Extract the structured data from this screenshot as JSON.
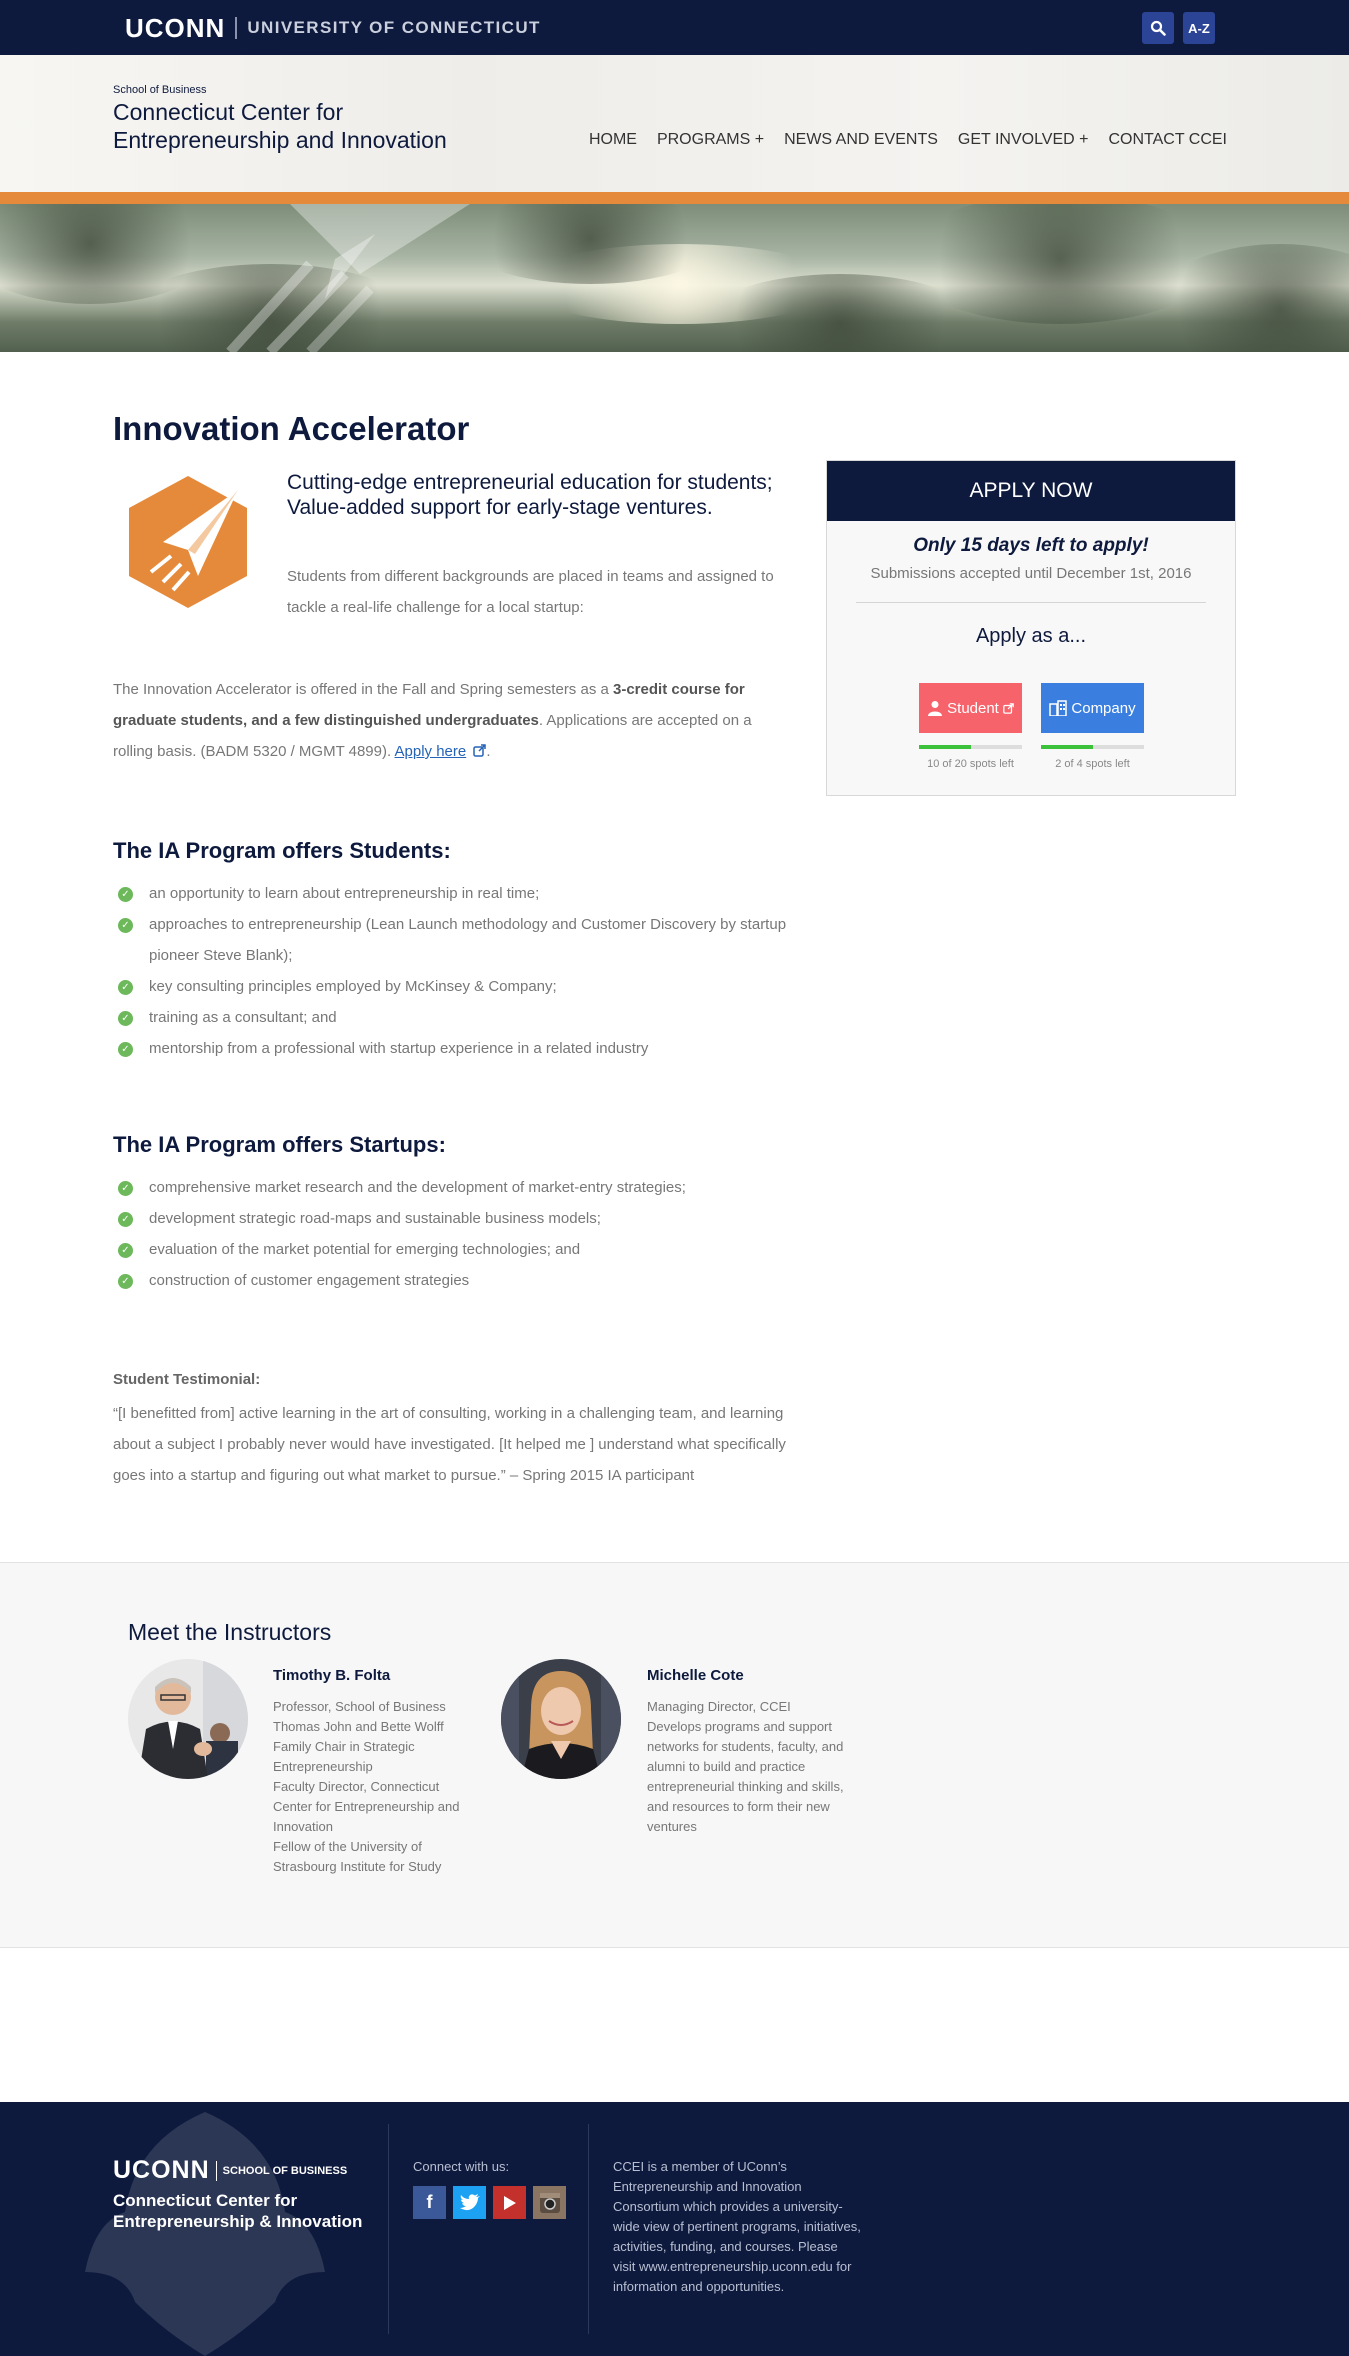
{
  "topbar": {
    "brand": "UCONN",
    "university": "UNIVERSITY OF CONNECTICUT",
    "search_icon": "search-icon",
    "az_label": "A-Z"
  },
  "header": {
    "school": "School of Business",
    "center_name": "Connecticut Center for Entrepreneurship and Innovation",
    "nav": [
      "HOME",
      "PROGRAMS +",
      "NEWS AND EVENTS",
      "GET INVOLVED +",
      "CONTACT CCEI"
    ]
  },
  "main": {
    "title": "Innovation Accelerator",
    "lead": "Cutting-edge entrepreneurial education for students; Value-added support for early-stage ventures.",
    "lead_text": "Students from different backgrounds are placed in teams and assigned to tackle a real-life challenge for a local startup:",
    "body_pre": "The Innovation Accelerator is offered in the Fall and Spring semesters as a ",
    "body_bold": "3-credit course for graduate students, and a few distinguished undergraduates",
    "body_post": ". Applications are accepted on a rolling basis. (BADM 5320 / MGMT 4899).  ",
    "apply_link": "Apply here",
    "students_heading": "The IA Program offers Students:",
    "students": [
      "an opportunity to learn about entrepreneurship in real time;",
      "approaches to entrepreneurship (Lean Launch methodology and Customer Discovery by startup pioneer Steve Blank);",
      "key consulting principles employed by McKinsey & Company;",
      "training as a consultant; and",
      "mentorship from a professional with startup experience in a related industry"
    ],
    "startups_heading": "The IA Program offers Startups:",
    "startups": [
      "comprehensive market research and the development of market-entry strategies;",
      "development strategic road-maps and sustainable business models;",
      "evaluation of the market potential for emerging technologies; and",
      "construction of customer engagement strategies"
    ],
    "testimonial_label": "Student Testimonial:",
    "testimonial": "“[I benefitted from] active learning in the art of consulting, working in a challenging team, and learning about a subject I probably never would have investigated. [It helped me ] understand what specifically goes into a startup and figuring out what market to pursue.”  – Spring 2015 IA participant"
  },
  "apply": {
    "heading": "APPLY NOW",
    "deadline": "Only 15 days left to apply!",
    "submissions": "Submissions accepted until December 1st, 2016",
    "apply_as": "Apply as a...",
    "student_label": "Student",
    "company_label": "Company",
    "student_spots": "10 of 20 spots left",
    "company_spots": "2 of 4 spots left",
    "student_fill": 0.5,
    "company_fill": 0.5,
    "student_color": "#f7636a",
    "company_color": "#3a7fe0"
  },
  "instructors": {
    "title": "Meet the Instructors",
    "people": [
      {
        "name": "Timothy B. Folta",
        "desc": "Professor, School of Business\nThomas John and Bette Wolff Family Chair in Strategic Entrepreneurship\nFaculty Director, Connecticut Center for Entrepreneurship and Innovation\nFellow of the University of Strasbourg Institute for Study"
      },
      {
        "name": "Michelle Cote",
        "desc": "Managing Director, CCEI\nDevelops programs and support networks for students, faculty, and alumni to build and practice entrepreneurial thinking and skills, and resources to form their new ventures"
      }
    ]
  },
  "footer": {
    "brand": "UCONN",
    "school": "SCHOOL OF BUSINESS",
    "center": "Connecticut Center for Entrepreneurship & Innovation",
    "connect": "Connect with us:",
    "social": [
      "facebook-icon",
      "twitter-icon",
      "youtube-icon",
      "instagram-icon"
    ],
    "about": "CCEI is a member of UConn’s Entrepreneurship and Innovation Consortium which provides a university-wide view of pertinent programs, initiatives, activities, funding, and courses. Please visit www.entrepreneurship.uconn.edu for information and opportunities."
  }
}
